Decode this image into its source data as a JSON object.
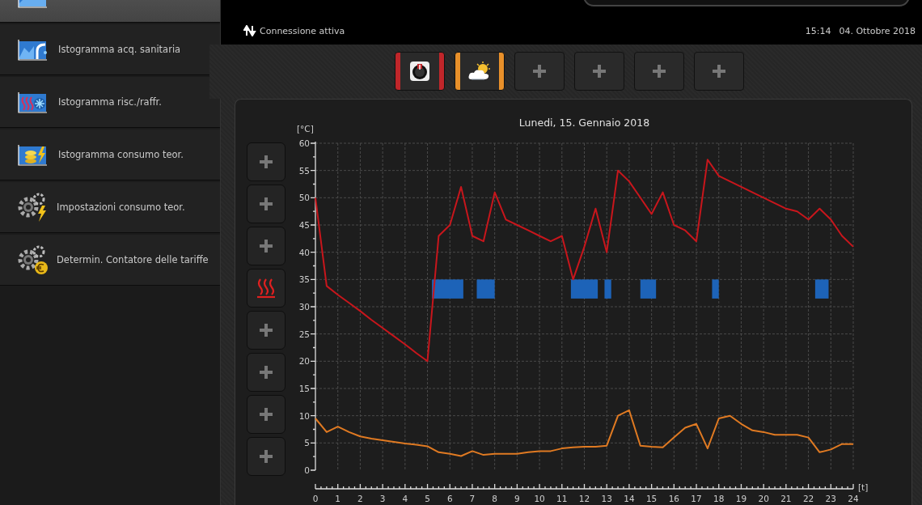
{
  "sidebar": {
    "items": [
      {
        "kind": "chart",
        "selected": true
      },
      {
        "kind": "tap-chart",
        "label": "Istogramma acq. sanitaria",
        "selected": false
      },
      {
        "kind": "heat-chart",
        "label": "Istogramma risc./raffr.",
        "selected": false
      },
      {
        "kind": "coin-chart",
        "label": "Istogramma consumo teor.",
        "selected": false
      },
      {
        "kind": "gear-bolt",
        "label": "Impostazioni consumo teor.",
        "selected": false
      },
      {
        "kind": "gear-euro",
        "label": "Determin. Contatore delle tariffe",
        "selected": false
      }
    ]
  },
  "header": {
    "connection": "Connessione attiva",
    "time": "15:14",
    "date": "04. Ottobre 2018"
  },
  "tiles": [
    {
      "kind": "scale",
      "color": "#c0262a"
    },
    {
      "kind": "weather",
      "color": "#e8902a"
    },
    {
      "kind": "add"
    },
    {
      "kind": "add"
    },
    {
      "kind": "add"
    },
    {
      "kind": "add"
    }
  ],
  "side_buttons": [
    {
      "kind": "add"
    },
    {
      "kind": "add"
    },
    {
      "kind": "add"
    },
    {
      "kind": "heating"
    },
    {
      "kind": "add"
    },
    {
      "kind": "add"
    },
    {
      "kind": "add"
    },
    {
      "kind": "add"
    }
  ],
  "chart": {
    "chart_data": {
      "type": "line",
      "title": "Lunedi, 15. Gennaio 2018",
      "xlabel": "[t]",
      "ylabel": "[°C]",
      "x": [
        0,
        0.5,
        1,
        1.5,
        2,
        2.5,
        3,
        3.5,
        4,
        4.5,
        5,
        5.5,
        6,
        6.5,
        7,
        7.5,
        8,
        8.5,
        9,
        9.5,
        10,
        10.5,
        11,
        11.5,
        12,
        12.5,
        13,
        13.5,
        14,
        14.5,
        15,
        15.5,
        16,
        16.5,
        17,
        17.5,
        18,
        18.5,
        19,
        19.5,
        20,
        20.5,
        21,
        21.5,
        22,
        22.5,
        23,
        23.5,
        24
      ],
      "series": [
        {
          "color": "#c8161c",
          "values": [
            50,
            33.8,
            32.2,
            30.7,
            29.2,
            27.6,
            26.1,
            24.6,
            23.1,
            21.5,
            20,
            43,
            45,
            52,
            43,
            42,
            51,
            46,
            45,
            44,
            43,
            42,
            43,
            35,
            41,
            48,
            40,
            55,
            53,
            50,
            47,
            51,
            45,
            44,
            42,
            57,
            54,
            53,
            52,
            51,
            50,
            49,
            48,
            47.5,
            46,
            48,
            46,
            43,
            41
          ]
        },
        {
          "color": "#e07a22",
          "values": [
            9.5,
            7,
            8,
            7,
            6.2,
            5.8,
            5.5,
            5.2,
            4.9,
            4.7,
            4.4,
            3.3,
            3,
            2.6,
            3.5,
            2.8,
            3,
            3,
            3,
            3.3,
            3.5,
            3.5,
            4,
            4.2,
            4.3,
            4.3,
            4.5,
            10,
            11,
            4.5,
            4.3,
            4.2,
            6,
            7.8,
            8.5,
            4,
            9.5,
            10,
            8.5,
            7.3,
            7,
            6.5,
            6.5,
            6.5,
            6,
            3.3,
            3.8,
            4.8,
            4.8
          ]
        }
      ],
      "xlim": [
        0,
        24
      ],
      "ylim": [
        0,
        60
      ],
      "xticks": [
        0,
        1,
        2,
        3,
        4,
        5,
        6,
        7,
        8,
        9,
        10,
        11,
        12,
        13,
        14,
        15,
        16,
        17,
        18,
        19,
        20,
        21,
        22,
        23,
        24
      ],
      "yticks": [
        0,
        5,
        10,
        15,
        20,
        25,
        30,
        35,
        40,
        45,
        50,
        55,
        60
      ],
      "grid": true,
      "bands": [
        {
          "axis": "x",
          "from": 5.2,
          "to": 6.6
        },
        {
          "axis": "x",
          "from": 7.2,
          "to": 8.0
        },
        {
          "axis": "x",
          "from": 11.4,
          "to": 12.6
        },
        {
          "axis": "x",
          "from": 12.9,
          "to": 13.2
        },
        {
          "axis": "x",
          "from": 14.5,
          "to": 15.2
        },
        {
          "axis": "x",
          "from": 17.7,
          "to": 18.0
        },
        {
          "axis": "x",
          "from": 22.3,
          "to": 22.9
        }
      ]
    }
  }
}
